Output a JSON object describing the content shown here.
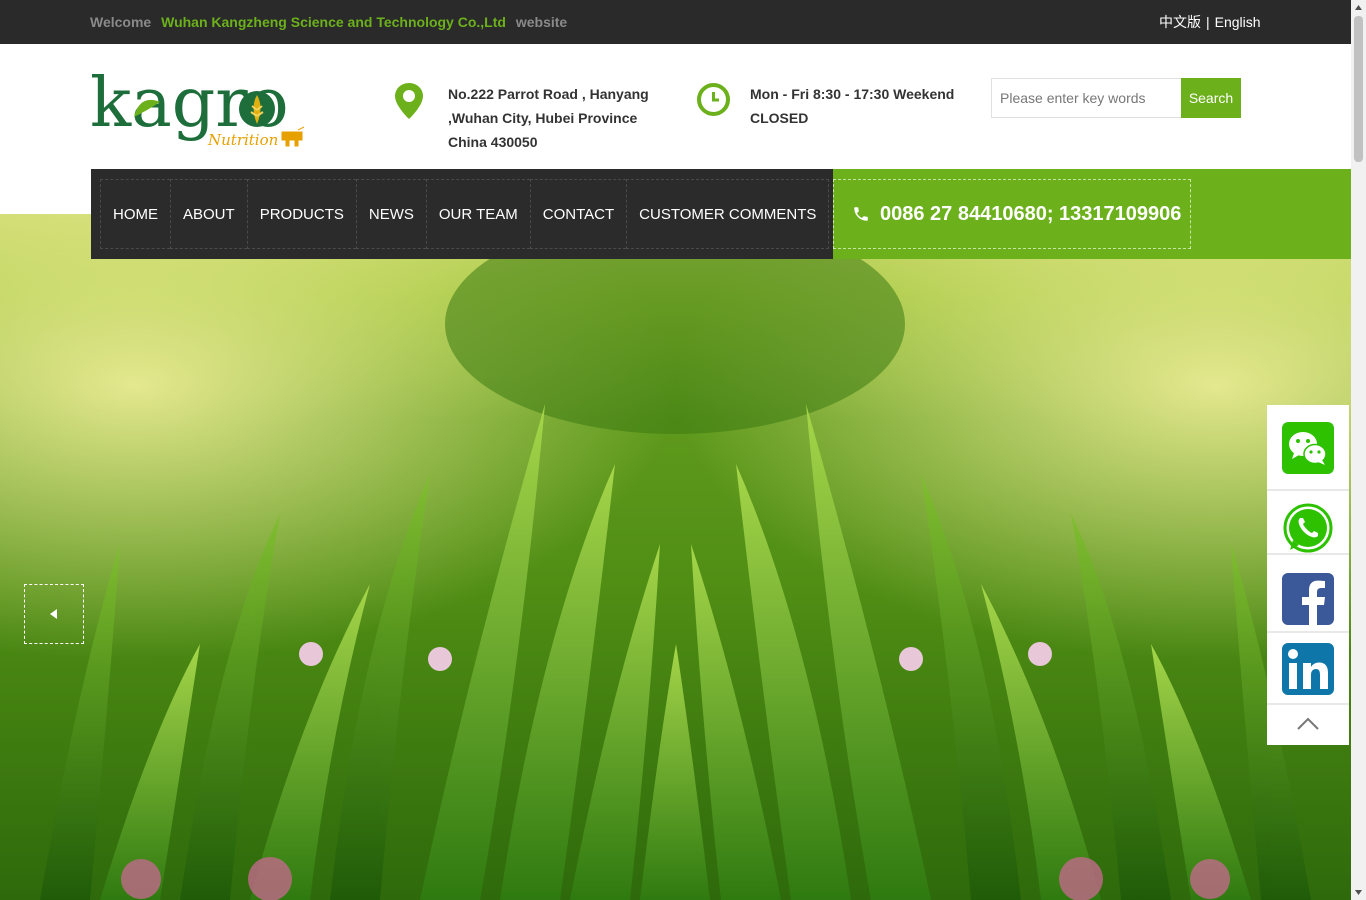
{
  "topbar": {
    "welcome_prefix": "Welcome",
    "company": "Wuhan Kangzheng Science and Technology Co.,Ltd",
    "welcome_suffix": "website",
    "lang_cn": "中文版",
    "lang_sep": "|",
    "lang_en": "English"
  },
  "brand": {
    "logo_text": "kagro",
    "logo_sub": "Nutrition"
  },
  "header": {
    "address": "No.222 Parrot Road , Hanyang ,Wuhan City, Hubei Province China 430050",
    "hours": "Mon - Fri 8:30 - 17:30 Weekend CLOSED",
    "search_placeholder": "Please enter key words",
    "search_button": "Search"
  },
  "nav": {
    "items": [
      "HOME",
      "ABOUT",
      "PRODUCTS",
      "NEWS",
      "OUR TEAM",
      "CONTACT",
      "CUSTOMER COMMENTS"
    ],
    "phone": "0086 27 84410680; 13317109906"
  },
  "social": [
    "wechat-icon",
    "whatsapp-icon",
    "facebook-icon",
    "linkedin-icon"
  ],
  "colors": {
    "accent": "#6cb11b",
    "topbar": "#2a2a2a",
    "nav": "#2b2b2b"
  }
}
